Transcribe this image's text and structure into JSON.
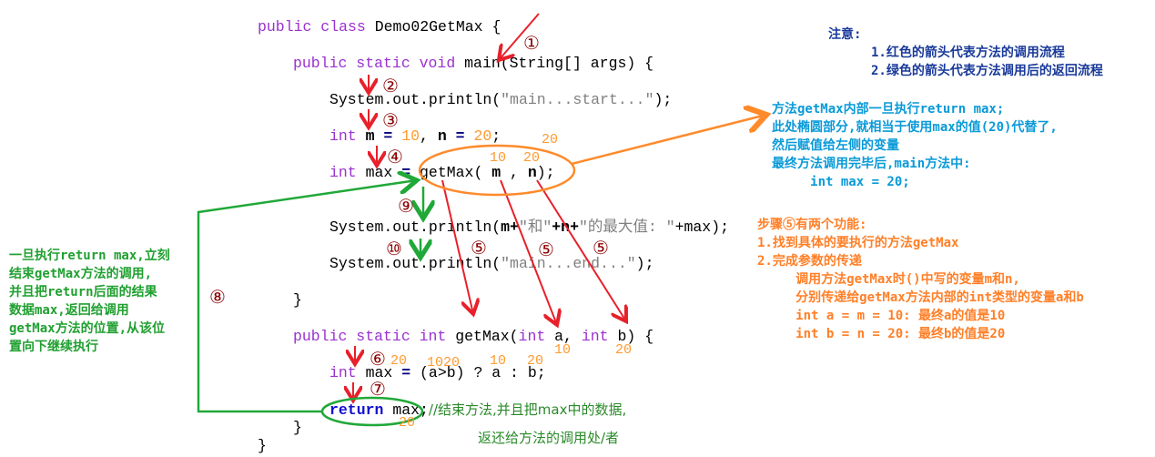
{
  "code": [
    {
      "tokens": [
        [
          "public class ",
          "kw"
        ],
        [
          "Demo02GetMax {",
          ""
        ]
      ]
    },
    {
      "tokens": [
        [
          "public static void ",
          "kw"
        ],
        [
          "main(String[] args) {",
          ""
        ]
      ]
    },
    {
      "tokens": [
        [
          "System.out.println(",
          ""
        ],
        [
          "\"main...start...\"",
          "str"
        ],
        [
          ");",
          ""
        ]
      ]
    },
    {
      "tokens": [
        [
          "int ",
          "kw"
        ],
        [
          "m",
          "bold"
        ],
        [
          " = ",
          "op"
        ],
        [
          "10",
          "num"
        ],
        [
          ", ",
          ""
        ],
        [
          "n",
          "bold"
        ],
        [
          " = ",
          "op"
        ],
        [
          "20",
          "num"
        ],
        [
          ";",
          ""
        ]
      ]
    },
    {
      "tokens": [
        [
          "int ",
          "kw"
        ],
        [
          "max ",
          ""
        ],
        [
          "= ",
          "op"
        ],
        [
          "getMax( ",
          ""
        ],
        [
          "m",
          "bold"
        ],
        [
          " , ",
          ""
        ],
        [
          "n",
          "bold"
        ],
        [
          ");",
          ""
        ]
      ]
    },
    {
      "tokens": [
        [
          "System.out.println(",
          ""
        ],
        [
          "m+",
          "bold"
        ],
        [
          "\"和\"",
          "str"
        ],
        [
          "+n+",
          "bold"
        ],
        [
          "\"的最大值: \"",
          "str"
        ],
        [
          "+max);",
          ""
        ]
      ]
    },
    {
      "tokens": [
        [
          "System.out.println(",
          ""
        ],
        [
          "\"main...end...\"",
          "str"
        ],
        [
          ");",
          ""
        ]
      ]
    },
    {
      "tokens": [
        [
          "}",
          ""
        ]
      ]
    },
    {
      "tokens": [
        [
          "public static int ",
          "kw"
        ],
        [
          "getMax(",
          ""
        ],
        [
          "int ",
          "kw"
        ],
        [
          "a, ",
          ""
        ],
        [
          "int ",
          "kw"
        ],
        [
          "b) {",
          ""
        ]
      ]
    },
    {
      "tokens": [
        [
          "int ",
          "kw"
        ],
        [
          "max ",
          ""
        ],
        [
          "= ",
          "op"
        ],
        [
          "(a>b) ? a : b;",
          ""
        ]
      ]
    },
    {
      "tokens": [
        [
          "return ",
          "kwb"
        ],
        [
          "max;",
          ""
        ],
        [
          "//结束方法,并且把max中的数据,",
          "cm"
        ]
      ]
    },
    {
      "tokens": [
        [
          "}",
          ""
        ]
      ]
    },
    {
      "tokens": [
        [
          "}",
          ""
        ]
      ]
    }
  ],
  "comment_cont": "返还给方法的调用处/者",
  "steps": [
    "①",
    "②",
    "③",
    "④",
    "⑤",
    "⑤",
    "⑤",
    "⑥",
    "⑦",
    "⑧",
    "⑨",
    "⑩"
  ],
  "values": [
    "20",
    "10",
    "20",
    "10",
    "20",
    "20",
    "1020",
    "10",
    "20",
    "20"
  ],
  "notice": {
    "title": "注意:",
    "lines": [
      "1.红色的箭头代表方法的调用流程",
      "2.绿色的箭头代表方法调用后的返回流程"
    ]
  },
  "blue_note": [
    "方法getMax内部一旦执行return max;",
    "此处椭圆部分,就相当于使用max的值(20)代替了,",
    "然后赋值给左侧的变量",
    "最终方法调用完毕后,main方法中:",
    "     int max = 20;"
  ],
  "orange_note": [
    "步骤⑤有两个功能:",
    "1.找到具体的要执行的方法getMax",
    "2.完成参数的传递",
    "     调用方法getMax时()中写的变量m和n,",
    "     分别传递给getMax方法内部的int类型的变量a和b",
    "     int a = m = 10: 最终a的值是10",
    "     int b = n = 20: 最终b的值是20"
  ],
  "green_note": [
    "一旦执行return max,立刻",
    "结束getMax方法的调用,",
    "并且把return后面的结果",
    "数据max,返回给调用",
    "getMax方法的位置,从该位",
    "置向下继续执行"
  ],
  "colors": {
    "call_arrow": "#e8202a",
    "return_arrow": "#20a838",
    "ellipse_orange": "#ff8a2a",
    "keyword": "#9b30d0"
  }
}
